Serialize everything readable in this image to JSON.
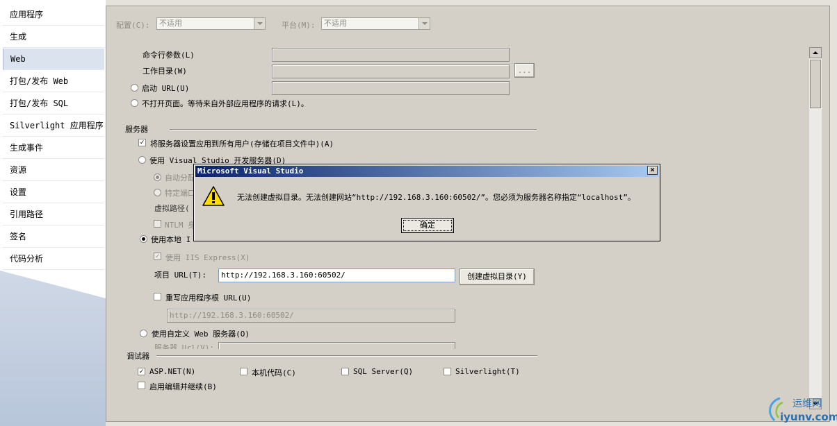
{
  "sidebar": {
    "items": [
      {
        "label": "应用程序",
        "active": false
      },
      {
        "label": "生成",
        "active": false
      },
      {
        "label": "Web",
        "active": true
      },
      {
        "label": "打包/发布 Web",
        "active": false
      },
      {
        "label": "打包/发布 SQL",
        "active": false
      },
      {
        "label": "Silverlight 应用程序",
        "active": false
      },
      {
        "label": "生成事件",
        "active": false
      },
      {
        "label": "资源",
        "active": false
      },
      {
        "label": "设置",
        "active": false
      },
      {
        "label": "引用路径",
        "active": false
      },
      {
        "label": "签名",
        "active": false
      },
      {
        "label": "代码分析",
        "active": false
      }
    ]
  },
  "toolbar": {
    "config_label": "配置(C):",
    "config_value": "不适用",
    "platform_label": "平台(M):",
    "platform_value": "不适用"
  },
  "start_action": {
    "cmdline_label": "命令行参数(L)",
    "workdir_label": "工作目录(W)",
    "browse_label": "...",
    "start_url_label": "启动 URL(U)",
    "no_open_label": "不打开页面。等待来自外部应用程序的请求(L)。"
  },
  "servers": {
    "header": "服务器",
    "apply_all_label": "将服务器设置应用到所有用户(存储在项目文件中)(A)",
    "vs_dev_label": "使用 Visual Studio 开发服务器(D)",
    "auto_port_label": "自动分配",
    "specific_port_label": "特定端口",
    "vpath_label": "虚拟路径(",
    "ntlm_label": "NTLM 身",
    "local_iis_label": "使用本地 I",
    "iis_express_label": "使用 IIS Express(X)",
    "project_url_label": "项目 URL(T):",
    "project_url_value": "http://192.168.3.160:60502/",
    "create_vdir_label": "创建虚拟目录(Y)",
    "override_root_label": "重写应用程序根 URL(U)",
    "override_root_value": "http://192.168.3.160:60502/",
    "custom_server_label": "使用自定义 Web 服务器(O)",
    "server_url_label": "服务器 Url(V):"
  },
  "debuggers": {
    "header": "调试器",
    "aspnet_label": "ASP.NET(N)",
    "native_label": "本机代码(C)",
    "sql_label": "SQL Server(Q)",
    "silverlight_label": "Silverlight(T)",
    "edit_continue_label": "启用编辑并继续(B)"
  },
  "dialog": {
    "title": "Microsoft Visual Studio",
    "close_label": "×",
    "message": "无法创建虚拟目录。无法创建网站“http://192.168.3.160:60502/”。您必须为服务器名称指定“localhost”。",
    "ok_label": "确定"
  },
  "watermark": {
    "line1": "运维网",
    "line2": "iyunv.com"
  },
  "colors": {
    "title_gradient_start": "#0a246a",
    "title_gradient_end": "#a6caf0",
    "panel_bg": "#d4d0c8",
    "sidebar_active": "#dbe3ee"
  }
}
